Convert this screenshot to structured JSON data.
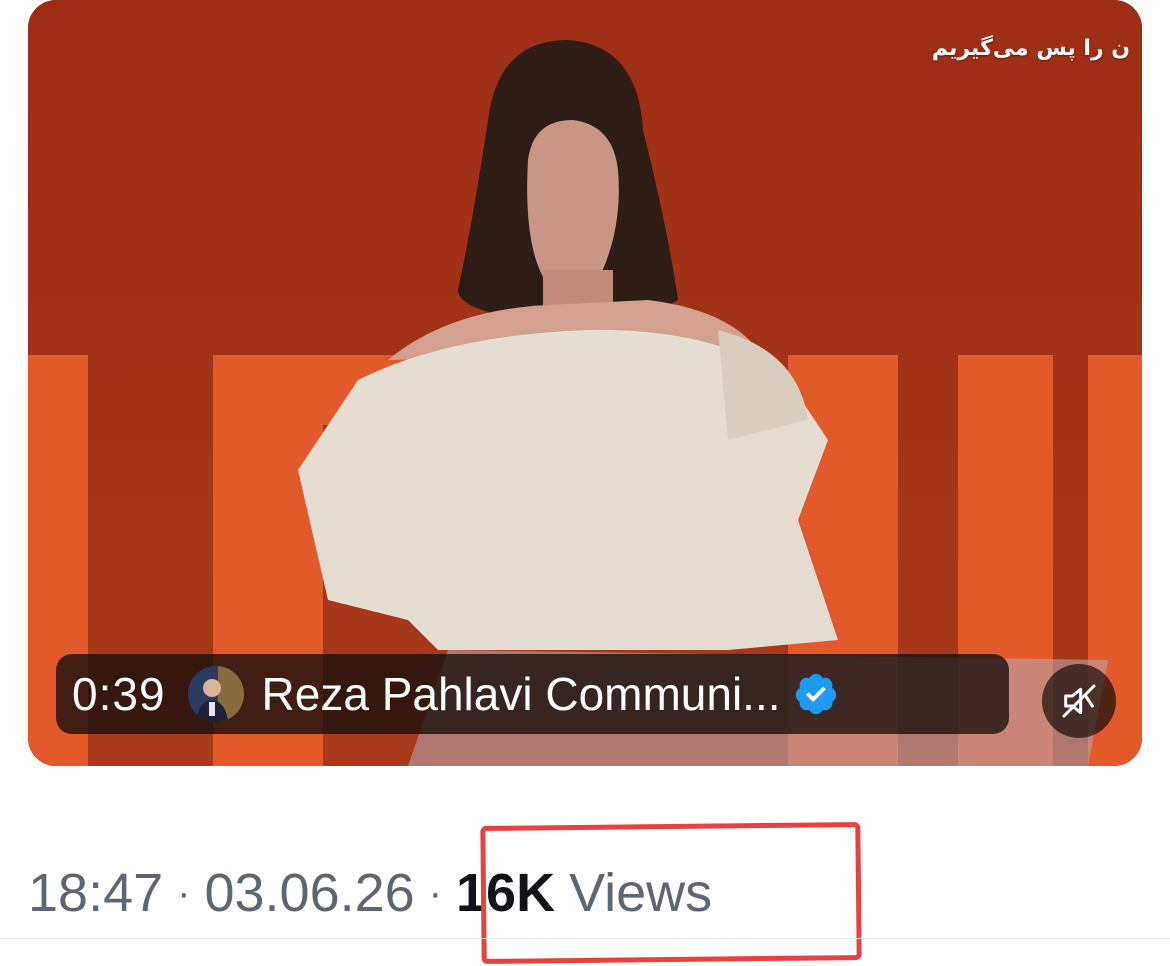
{
  "video": {
    "overlay_caption": "ن را پس می‌گیریم",
    "duration": "0:39",
    "account_name": "Reza Pahlavi Communi...",
    "verified": true,
    "muted": true
  },
  "tweet_meta": {
    "time": "18:47",
    "date": "03.06.26",
    "separator": "·",
    "views_count": "16K",
    "views_label": "Views"
  },
  "colors": {
    "verified_badge": "#1d9bf0",
    "highlight": "#e8413f",
    "backdrop": "#a8331a"
  },
  "icons": {
    "verified": "verified-badge-icon",
    "mute": "speaker-muted-icon"
  }
}
